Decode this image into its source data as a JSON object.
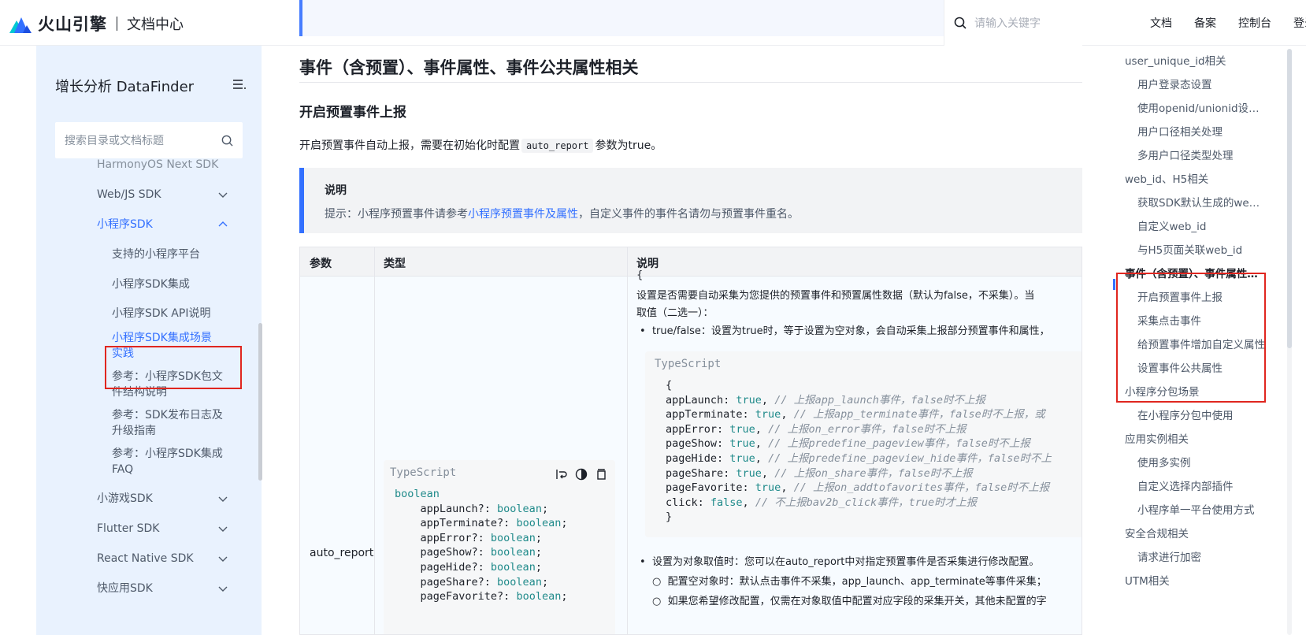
{
  "header": {
    "brand": "火山引擎",
    "section": "文档中心",
    "search_placeholder": "请输入关键字",
    "nav": [
      "文档",
      "备案",
      "控制台",
      "登录"
    ]
  },
  "sidebar": {
    "title": "增长分析 DataFinder",
    "search_placeholder": "搜索目录或文档标题",
    "items": [
      {
        "label": "HarmonyOS Next SDK"
      },
      {
        "label": "Web/JS SDK"
      },
      {
        "label": "小程序SDK"
      },
      {
        "label": "支持的小程序平台"
      },
      {
        "label": "小程序SDK集成"
      },
      {
        "label": "小程序SDK API说明"
      },
      {
        "label": "小程序SDK集成场景实践"
      },
      {
        "label": "参考：小程序SDK包文件结构说明"
      },
      {
        "label": "参考：SDK发布日志及升级指南"
      },
      {
        "label": "参考：小程序SDK集成FAQ"
      },
      {
        "label": "小游戏SDK"
      },
      {
        "label": "Flutter SDK"
      },
      {
        "label": "React Native SDK"
      },
      {
        "label": "快应用SDK"
      }
    ]
  },
  "content": {
    "h1": "事件（含预置）、事件属性、事件公共属性相关",
    "h2": "开启预置事件上报",
    "para_before": "开启预置事件自动上报，需要在初始化时配置",
    "para_code": "auto_report",
    "para_after": "参数为true。",
    "note": {
      "title": "说明",
      "text_before": "提示：小程序预置事件请参考",
      "link": "小程序预置事件及属性",
      "text_after": "，自定义事件的事件名请勿与预置事件重名。"
    },
    "table": {
      "headers": [
        "参数",
        "类型",
        "说明"
      ],
      "param": "auto_report",
      "type_code_lang": "TypeScript",
      "desc_lines": [
        "{",
        "设置是否需要自动采集为您提供的预置事件和预置属性数据（默认为false，不采集）。当",
        "取值（二选一）：",
        "true/false：设置为true时，等于设置为空对象，会自动采集上报部分预置事件和属性，"
      ],
      "desc_code_lang": "TypeScript",
      "desc_after": [
        "设置为对象取值时：您可以在auto_report中对指定预置事件是否采集进行修改配置。",
        "配置空对象时：默认点击事件不采集，app_launch、app_terminate等事件采集；",
        "如果您希望修改配置，仅需在对象取值中配置对应字段的采集开关，其他未配置的字"
      ]
    }
  },
  "toc": {
    "items": [
      {
        "label": "user_unique_id相关",
        "level": 1
      },
      {
        "label": "用户登录态设置",
        "level": 2
      },
      {
        "label": "使用openid/unionid设置user_unique_id",
        "level": 2
      },
      {
        "label": "用户口径相关处理",
        "level": 2
      },
      {
        "label": "多用户口径类型处理",
        "level": 2
      },
      {
        "label": "web_id、H5相关",
        "level": 1
      },
      {
        "label": "获取SDK默认生成的web_id",
        "level": 2
      },
      {
        "label": "自定义web_id",
        "level": 2
      },
      {
        "label": "与H5页面关联web_id",
        "level": 2
      },
      {
        "label": "事件（含预置）、事件属性、事件公共属性相关",
        "level": 1
      },
      {
        "label": "开启预置事件上报",
        "level": 2
      },
      {
        "label": "采集点击事件",
        "level": 2
      },
      {
        "label": "给预置事件增加自定义属性",
        "level": 2
      },
      {
        "label": "设置事件公共属性",
        "level": 2
      },
      {
        "label": "小程序分包场景",
        "level": 1
      },
      {
        "label": "在小程序分包中使用",
        "level": 2
      },
      {
        "label": "应用实例相关",
        "level": 1
      },
      {
        "label": "使用多实例",
        "level": 2
      },
      {
        "label": "自定义选择内部插件",
        "level": 2
      },
      {
        "label": "小程序单一平台使用方式",
        "level": 2
      },
      {
        "label": "安全合规相关",
        "level": 1
      },
      {
        "label": "请求进行加密",
        "level": 2
      },
      {
        "label": "UTM相关",
        "level": 1
      }
    ]
  },
  "colors": {
    "accent": "#3370ff",
    "sidebar_bg": "#e9f2fe",
    "highlight_box": "#e0261f"
  },
  "icons": [
    "volcano-logo-icon",
    "search-icon",
    "menu-icon",
    "chevron-down-icon",
    "chevron-up-icon",
    "wrap-icon",
    "theme-icon",
    "copy-icon"
  ]
}
